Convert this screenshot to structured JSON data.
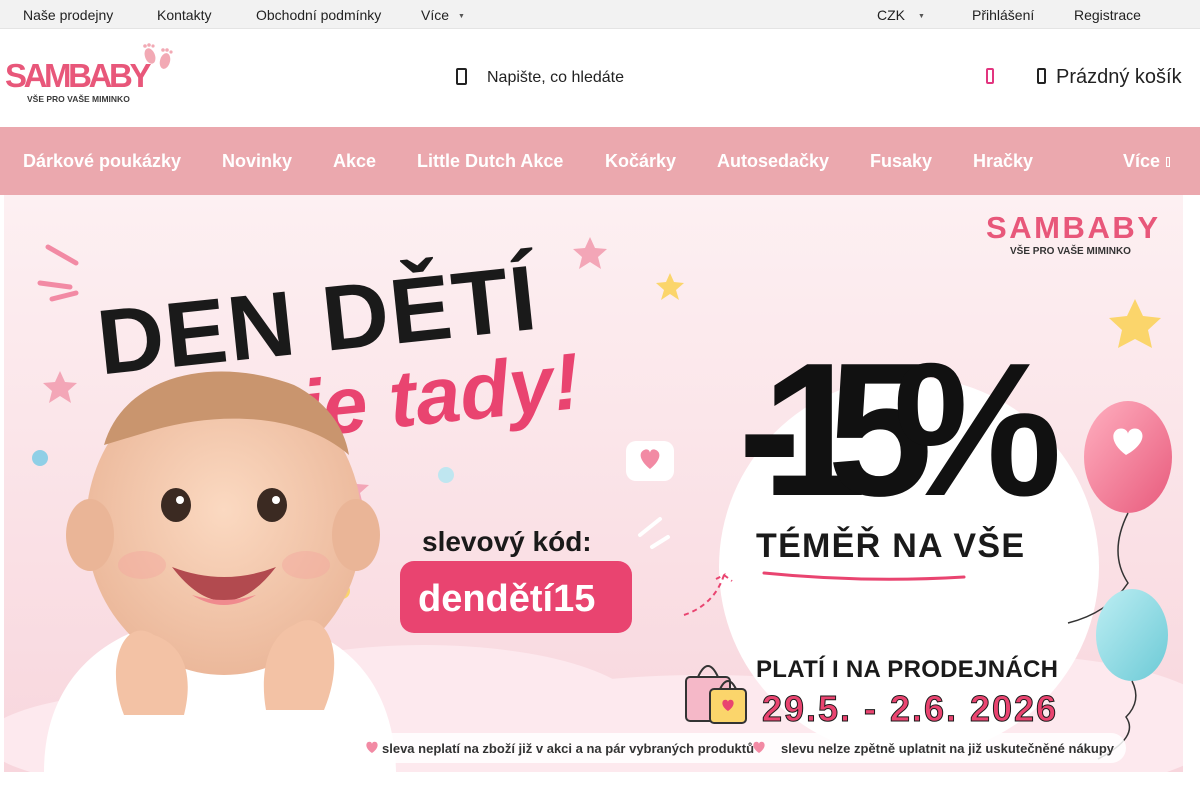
{
  "topbar": {
    "links": [
      "Naše prodejny",
      "Kontakty",
      "Obchodní podmínky",
      "Více"
    ],
    "currency": "CZK",
    "login": "Přihlášení",
    "register": "Registrace"
  },
  "header": {
    "logo_text": "SAMBABY",
    "logo_tagline": "VŠE PRO VAŠE MIMINKO",
    "search_placeholder": "Napište, co hledáte",
    "cart_label": "Prázdný košík"
  },
  "nav": {
    "items": [
      "Dárkové poukázky",
      "Novinky",
      "Akce",
      "Little Dutch Akce",
      "Kočárky",
      "Autosedačky",
      "Fusaky",
      "Hračky"
    ],
    "more": "Více"
  },
  "banner": {
    "logo_text": "SAMBABY",
    "logo_tagline": "VŠE PRO VAŠE MIMINKO",
    "headline_1": "DEN DĚTÍ",
    "headline_2": "je tady!",
    "code_label": "slevový kód:",
    "code": "dendětí15",
    "discount": "-15%",
    "discount_sub": "TÉMĚŘ NA VŠE",
    "stores_line": "PLATÍ I NA PRODEJNÁCH",
    "dates": "29.5. - 2.6. 2026",
    "footnote_1": "sleva neplatí na zboží již v akci a na pár vybraných produktů",
    "footnote_2": "slevu nelze zpětně uplatnit na již uskutečněné nákupy"
  },
  "colors": {
    "nav_bg": "#eba8ae",
    "brand_pink": "#e8577a",
    "code_pink": "#e94470",
    "banner_bg": "#fbe9ec"
  }
}
